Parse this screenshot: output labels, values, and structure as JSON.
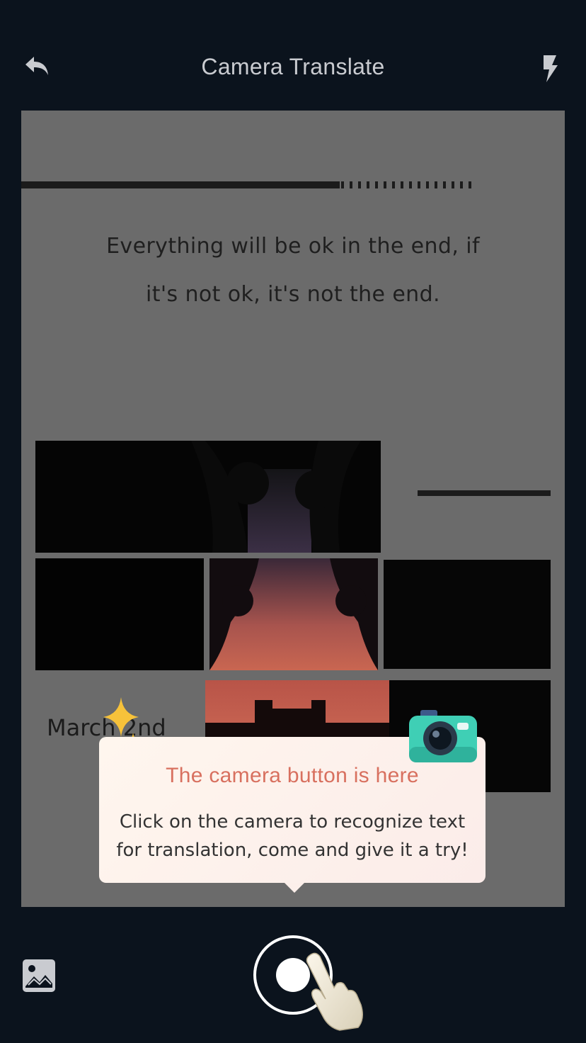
{
  "header": {
    "back_icon": "back-arrow-icon",
    "title": "Camera Translate",
    "flash_icon": "flash-icon"
  },
  "preview": {
    "quote": "Everything will be ok in the end, if it's not ok, it's not the end.",
    "date_text": "March 2nd"
  },
  "tooltip": {
    "title": "The camera button is here",
    "body": "Click on the camera to recognize text for translation, come and give it a try!",
    "accent_color": "#d8705f"
  },
  "bottom": {
    "gallery_icon": "gallery-icon",
    "shutter_icon": "shutter-icon",
    "pointer_icon": "pointing-hand-icon"
  }
}
